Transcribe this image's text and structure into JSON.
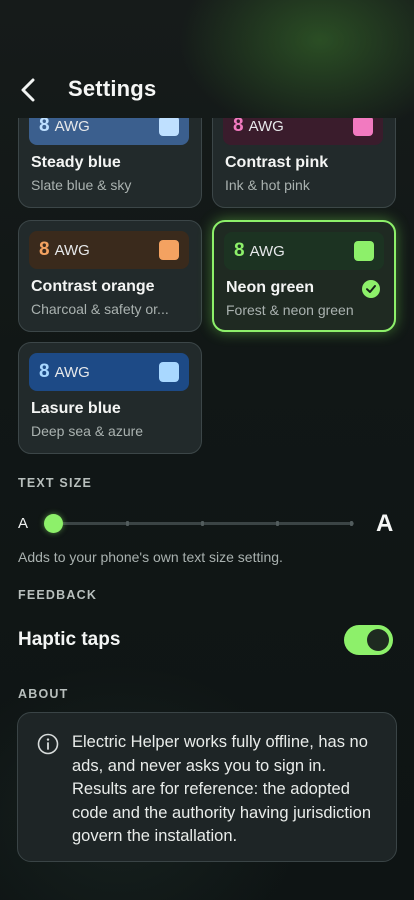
{
  "header": {
    "title": "Settings"
  },
  "themes": [
    {
      "gauge": "8",
      "unit": "AWG",
      "name": "Steady blue",
      "sub": "Slate blue & sky",
      "swatch_bg": "#3b5f8e",
      "num_color": "#bfe0ff",
      "chip": "#bfe0ff",
      "selected": false
    },
    {
      "gauge": "8",
      "unit": "AWG",
      "name": "Contrast pink",
      "sub": "Ink & hot pink",
      "swatch_bg": "#3a1c2c",
      "num_color": "#f27ac0",
      "chip": "#f27ac0",
      "selected": false
    },
    {
      "gauge": "8",
      "unit": "AWG",
      "name": "Contrast orange",
      "sub": "Charcoal & safety or...",
      "swatch_bg": "#3a2a1c",
      "num_color": "#f4a261",
      "chip": "#f4a261",
      "selected": false
    },
    {
      "gauge": "8",
      "unit": "AWG",
      "name": "Neon green",
      "sub": "Forest & neon green",
      "swatch_bg": "#1c3322",
      "num_color": "#8df06a",
      "chip": "#8df06a",
      "selected": true
    },
    {
      "gauge": "8",
      "unit": "AWG",
      "name": "Lasure blue",
      "sub": "Deep sea & azure",
      "swatch_bg": "#1d4a86",
      "num_color": "#a9d8ff",
      "chip": "#a9d8ff",
      "selected": false
    }
  ],
  "text_size": {
    "label": "TEXT SIZE",
    "small": "A",
    "large": "A",
    "hint": "Adds to your phone's own text size setting.",
    "level_fraction": 0
  },
  "feedback": {
    "label": "FEEDBACK",
    "haptic_label": "Haptic taps",
    "haptic_on": true
  },
  "about": {
    "label": "ABOUT",
    "text": "Electric Helper works fully offline, has no ads, and never asks you to sign in. Results are for reference: the adopted code and the authority having jurisdiction govern the installation."
  },
  "colors": {
    "accent": "#8df06a",
    "background": "#111716",
    "card": "#222a2b"
  },
  "icons": {
    "back": "chevron-left-icon",
    "check": "check-circle-icon",
    "info": "info-circle-icon"
  }
}
